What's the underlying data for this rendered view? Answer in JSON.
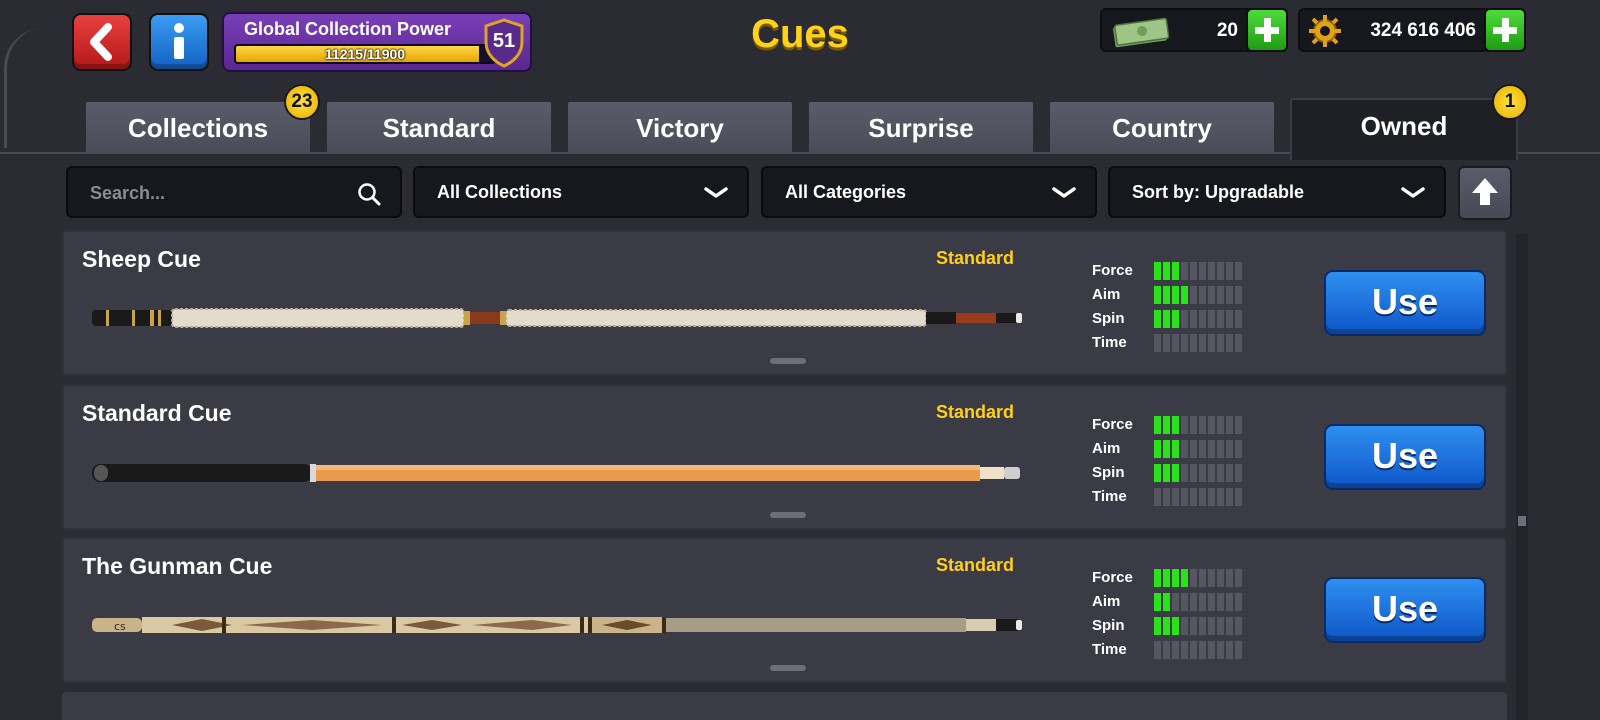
{
  "header": {
    "title": "Cues",
    "back_icon": "back-arrow-icon",
    "info_icon": "info-icon",
    "power": {
      "label": "Global Collection Power",
      "current": 11215,
      "max": 11900,
      "progress_text": "11215/11900",
      "level": "51"
    },
    "cash": {
      "icon": "cash-icon",
      "value": "20"
    },
    "coins": {
      "icon": "coin-icon",
      "value": "324 616 406"
    }
  },
  "tabs": [
    {
      "label": "Collections",
      "badge": "23",
      "active": false
    },
    {
      "label": "Standard",
      "active": false
    },
    {
      "label": "Victory",
      "active": false
    },
    {
      "label": "Surprise",
      "active": false
    },
    {
      "label": "Country",
      "active": false
    },
    {
      "label": "Owned",
      "badge": "1",
      "active": true
    }
  ],
  "filters": {
    "search_placeholder": "Search...",
    "collection": "All Collections",
    "category": "All Categories",
    "sort": "Sort by: Upgradable"
  },
  "stat_labels": [
    "Force",
    "Aim",
    "Spin",
    "Time"
  ],
  "cues": [
    {
      "name": "Sheep Cue",
      "category": "Standard",
      "stats": {
        "force": 3,
        "aim": 4,
        "spin": 3,
        "time": 0
      },
      "action": "Use",
      "colors": {
        "butt": "#1a1a1a",
        "shaft": "#e3dccd",
        "accent": "#c9a24a"
      }
    },
    {
      "name": "Standard Cue",
      "category": "Standard",
      "stats": {
        "force": 3,
        "aim": 3,
        "spin": 3,
        "time": 0
      },
      "action": "Use",
      "colors": {
        "butt": "#1a1a1a",
        "shaft": "#e89a4e",
        "accent": "#cfcfcf"
      }
    },
    {
      "name": "The Gunman Cue",
      "category": "Standard",
      "stats": {
        "force": 4,
        "aim": 2,
        "spin": 3,
        "time": 0
      },
      "action": "Use",
      "colors": {
        "butt": "#c9b48a",
        "shaft": "#a89c86",
        "accent": "#6b4a2a"
      }
    }
  ],
  "stat_max": 10
}
